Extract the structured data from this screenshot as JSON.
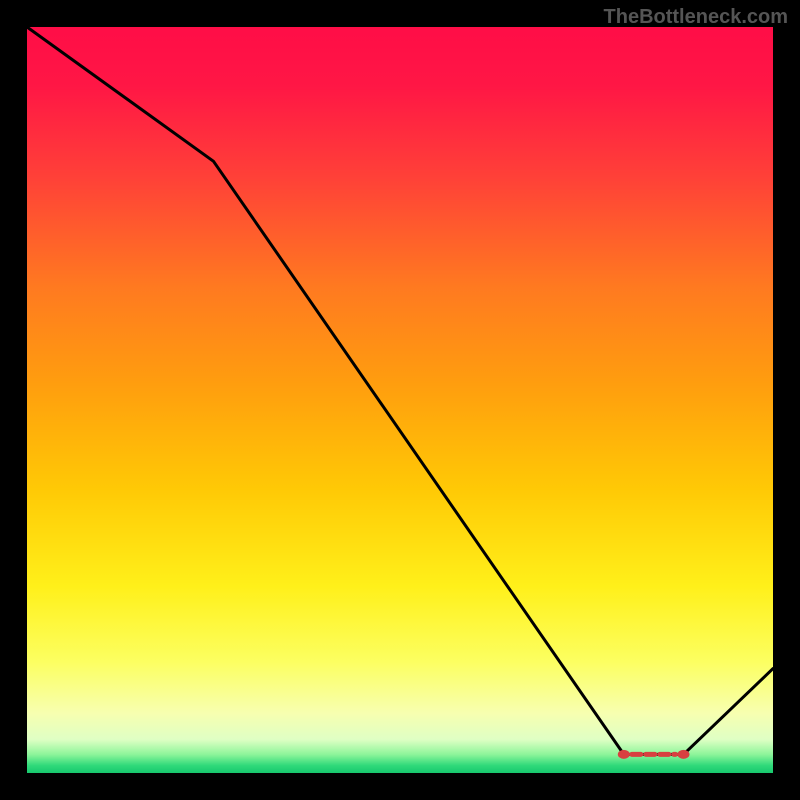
{
  "watermark": "TheBottleneck.com",
  "chart_data": {
    "type": "line",
    "title": "",
    "xlabel": "",
    "ylabel": "",
    "xlim": [
      0,
      100
    ],
    "ylim": [
      0,
      100
    ],
    "series": [
      {
        "name": "curve",
        "x": [
          0,
          25,
          80,
          88,
          100
        ],
        "y": [
          100,
          82,
          2.5,
          2.5,
          14
        ]
      }
    ],
    "flat_segment": {
      "x_start": 80,
      "x_end": 88,
      "y": 2.5
    },
    "gradient_stops": [
      {
        "offset": 0.0,
        "color": "#ff0d47"
      },
      {
        "offset": 0.08,
        "color": "#ff1745"
      },
      {
        "offset": 0.2,
        "color": "#ff4038"
      },
      {
        "offset": 0.35,
        "color": "#ff7a20"
      },
      {
        "offset": 0.48,
        "color": "#ff9e0e"
      },
      {
        "offset": 0.62,
        "color": "#ffc905"
      },
      {
        "offset": 0.75,
        "color": "#fff01a"
      },
      {
        "offset": 0.85,
        "color": "#fcff60"
      },
      {
        "offset": 0.92,
        "color": "#f7ffb0"
      },
      {
        "offset": 0.955,
        "color": "#dfffc4"
      },
      {
        "offset": 0.975,
        "color": "#8ef59a"
      },
      {
        "offset": 0.99,
        "color": "#2fd97a"
      },
      {
        "offset": 1.0,
        "color": "#17c96e"
      }
    ]
  }
}
